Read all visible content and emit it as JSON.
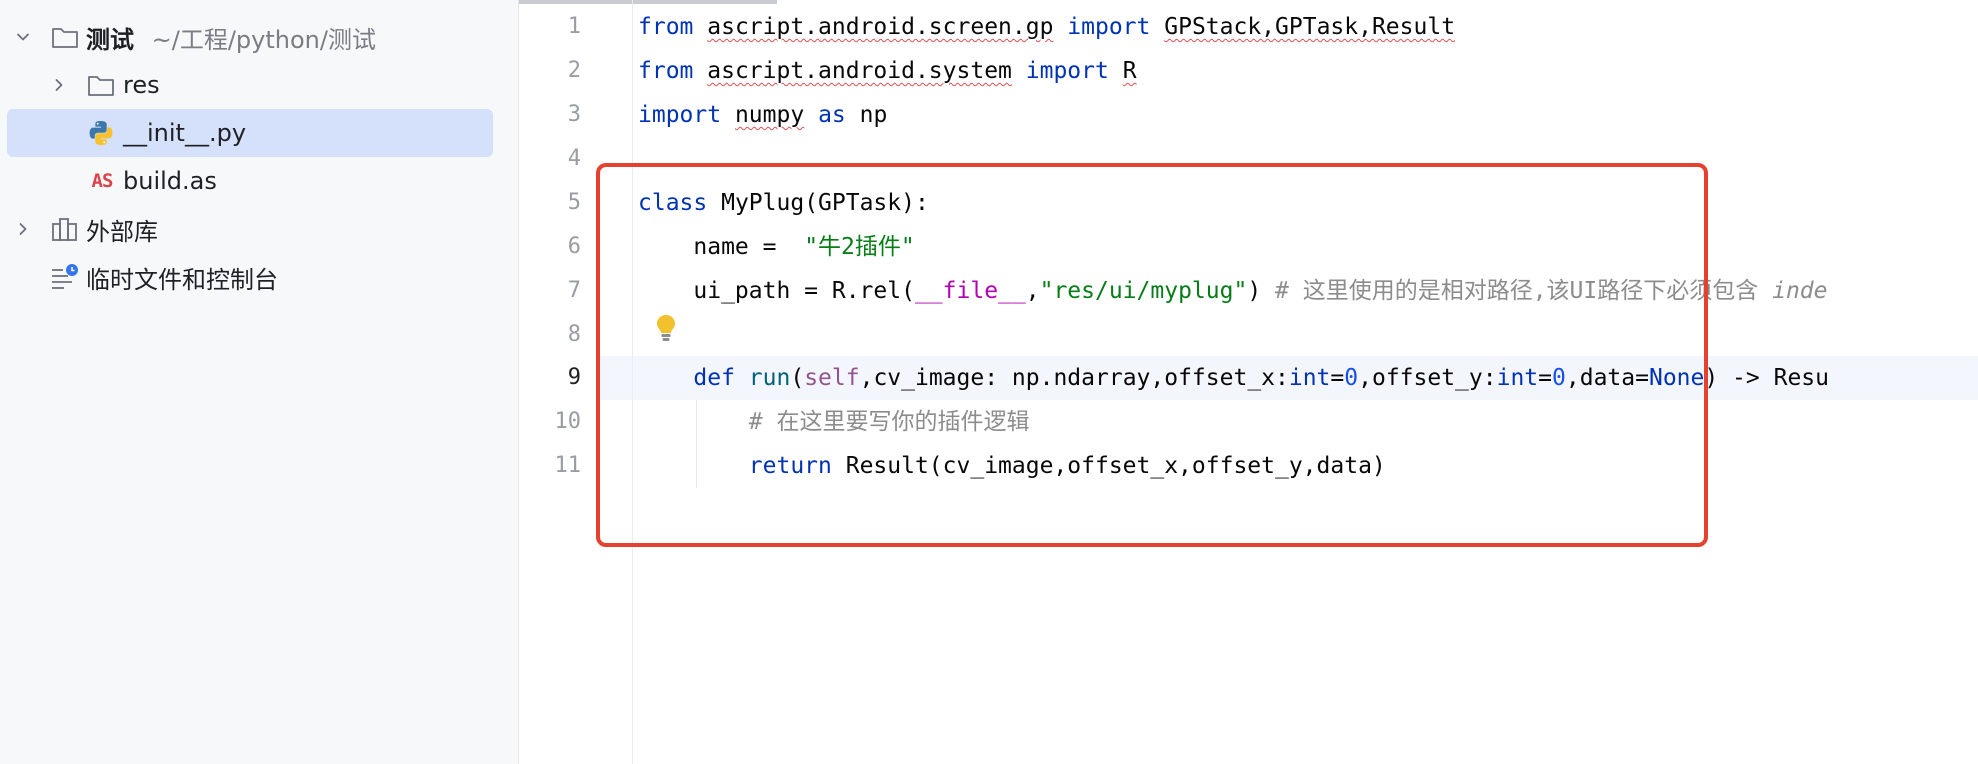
{
  "project_tree": {
    "root": {
      "name": "测试",
      "path": "~/工程/python/测试"
    },
    "items": [
      {
        "label": "res"
      },
      {
        "label": "__init__.py"
      },
      {
        "label": "build.as",
        "icon_text": "AS"
      },
      {
        "label": "外部库"
      },
      {
        "label": "临时文件和控制台"
      }
    ]
  },
  "editor": {
    "line_numbers": [
      "1",
      "2",
      "3",
      "4",
      "5",
      "6",
      "7",
      "8",
      "9",
      "10",
      "11"
    ],
    "active_line": "9",
    "code": {
      "l1": {
        "kw_from": "from",
        "module": "ascript.android.screen.gp",
        "kw_import": "import",
        "names": "GPStack,GPTask,Result"
      },
      "l2": {
        "kw_from": "from",
        "module": "ascript.android.system",
        "kw_import": "import",
        "names": "R"
      },
      "l3": {
        "kw_import": "import",
        "module": "numpy",
        "kw_as": "as",
        "alias": "np"
      },
      "l5": {
        "kw_class": "class",
        "rest": "MyPlug(GPTask):"
      },
      "l6": {
        "lhs": "name = ",
        "value": "\"牛2插件\""
      },
      "l7": {
        "a": "ui_path = R.rel(",
        "dunder": "__file__",
        "comma": ",",
        "str": "\"res/ui/myplug\"",
        "close": ") ",
        "comment": "# 这里使用的是相对路径,该UI路径下必须包含 ",
        "comment_italic": "inde"
      },
      "l9": {
        "kw_def": "def",
        "fn": "run",
        "p1": "(",
        "self": "self",
        "p2": ",cv_image: np.ndarray,offset_x:",
        "int1": "int",
        "eq1": "=",
        "zero1": "0",
        "p3": ",offset_y:",
        "int2": "int",
        "eq2": "=",
        "zero2": "0",
        "p4": ",data=",
        "none": "None",
        "p5": ") -> Resu"
      },
      "l10": {
        "comment": "# 在这里要写你的插件逻辑"
      },
      "l11": {
        "kw_return": "return",
        "rest": " Result(cv_image,offset_x,offset_y,data)"
      }
    }
  },
  "colors": {
    "keyword": "#0033b3",
    "string": "#067d17",
    "comment": "#8c8c8c",
    "highlight_box": "#e5412f",
    "selection": "#d5e1fb"
  }
}
